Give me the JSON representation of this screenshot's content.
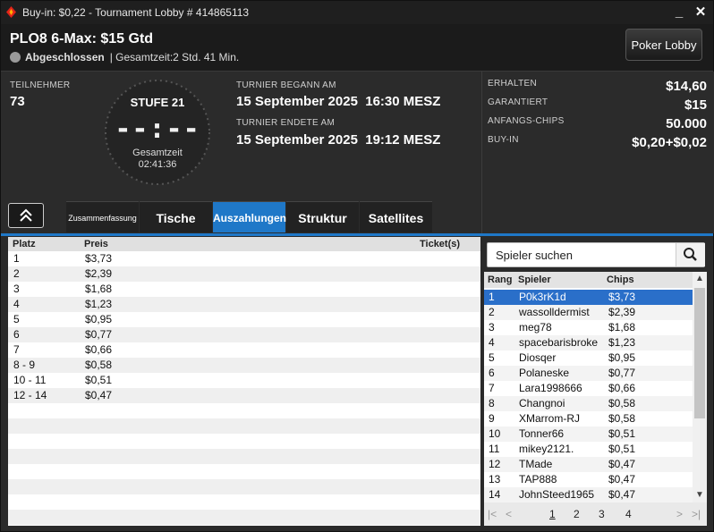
{
  "window": {
    "title": "Buy-in: $0,22 - Tournament Lobby # 414865113",
    "minimize_label": "_",
    "close_label": "✕"
  },
  "header": {
    "tournament_name": "PLO8 6-Max: $15 Gtd",
    "status": "Abgeschlossen",
    "duration": "| Gesamtzeit:2 Std.  41 Min.",
    "poker_lobby_label": "Poker Lobby"
  },
  "info": {
    "participants_label": "TEILNEHMER",
    "participants_value": "73",
    "level_label": "STUFE 21",
    "clock_digits": "--:--",
    "total_time_label": "Gesamtzeit",
    "total_time_value": "02:41:36",
    "started_label": "TURNIER BEGANN AM",
    "started_value": "15 September 2025  16:30 MESZ",
    "ended_label": "TURNIER ENDETE AM",
    "ended_value": "15 September 2025  19:12 MESZ"
  },
  "prize_info": {
    "received_label": "ERHALTEN",
    "received_value": "$14,60",
    "guaranteed_label": "GARANTIERT",
    "guaranteed_value": "$15",
    "start_chips_label": "ANFANGS-CHIPS",
    "start_chips_value": "50.000",
    "buyin_label": "BUY-IN",
    "buyin_value": "$0,20+$0,02"
  },
  "tabs": [
    {
      "label": "Zusammenfassung"
    },
    {
      "label": "Tische"
    },
    {
      "label": "Auszahlungen"
    },
    {
      "label": "Struktur"
    },
    {
      "label": "Satellites"
    }
  ],
  "active_tab": "Auszahlungen",
  "payouts": {
    "columns": [
      "Platz",
      "Preis",
      "Ticket(s)"
    ],
    "rows": [
      {
        "place": "1",
        "prize": "$3,73"
      },
      {
        "place": "2",
        "prize": "$2,39"
      },
      {
        "place": "3",
        "prize": "$1,68"
      },
      {
        "place": "4",
        "prize": "$1,23"
      },
      {
        "place": "5",
        "prize": "$0,95"
      },
      {
        "place": "6",
        "prize": "$0,77"
      },
      {
        "place": "7",
        "prize": "$0,66"
      },
      {
        "place": "8 - 9",
        "prize": "$0,58"
      },
      {
        "place": "10 - 11",
        "prize": "$0,51"
      },
      {
        "place": "12 - 14",
        "prize": "$0,47"
      }
    ]
  },
  "players": {
    "search_placeholder": "Spieler suchen",
    "columns": [
      "Rang",
      "Spieler",
      "Chips"
    ],
    "rows": [
      {
        "rank": "1",
        "name": "P0k3rK1d",
        "chips": "$3,73"
      },
      {
        "rank": "2",
        "name": "wassolldermist",
        "chips": "$2,39"
      },
      {
        "rank": "3",
        "name": "meg78",
        "chips": "$1,68"
      },
      {
        "rank": "4",
        "name": "spacebarisbroke",
        "chips": "$1,23"
      },
      {
        "rank": "5",
        "name": "Diosqer",
        "chips": "$0,95"
      },
      {
        "rank": "6",
        "name": "Polaneske",
        "chips": "$0,77"
      },
      {
        "rank": "7",
        "name": "Lara1998666",
        "chips": "$0,66"
      },
      {
        "rank": "8",
        "name": "Changnoi",
        "chips": "$0,58"
      },
      {
        "rank": "9",
        "name": "XMarrom-RJ",
        "chips": "$0,58"
      },
      {
        "rank": "10",
        "name": "Tonner66",
        "chips": "$0,51"
      },
      {
        "rank": "11",
        "name": "mikey2121.",
        "chips": "$0,51"
      },
      {
        "rank": "12",
        "name": "TMade",
        "chips": "$0,47"
      },
      {
        "rank": "13",
        "name": "TAP888",
        "chips": "$0,47"
      },
      {
        "rank": "14",
        "name": "JohnSteed1965",
        "chips": "$0,47"
      }
    ],
    "selected_rank": "1",
    "pages": [
      "1",
      "2",
      "3",
      "4"
    ],
    "current_page": "1"
  },
  "colors": {
    "accent": "#1f78c8",
    "selected_row": "#2a6fc9",
    "logo_red": "#e2231a"
  }
}
